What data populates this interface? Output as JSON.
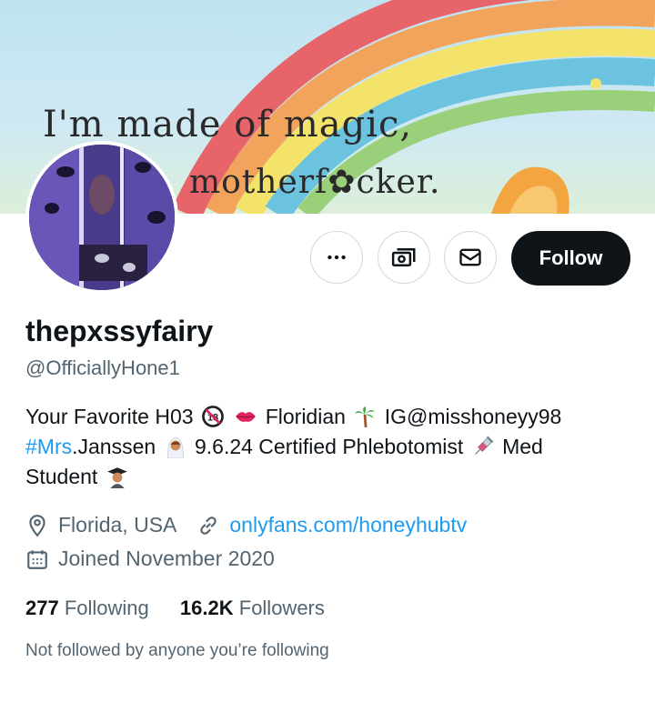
{
  "banner": {
    "line1": "I'm made of magic,",
    "line2": "motherf✿cker."
  },
  "actions": {
    "more_icon": "more-horizontal-icon",
    "subscribe_icon": "money-icon",
    "message_icon": "envelope-icon",
    "follow_label": "Follow"
  },
  "profile": {
    "name": "thepxssyfairy",
    "handle": "@OfficiallyHone1",
    "bio": {
      "part1": "Your Favorite H03",
      "part2": "Floridian",
      "part3": "IG@misshoneyy98",
      "hashtag": "#Mrs",
      "part4": ".Janssen",
      "part5": "9.6.24  Certified Phlebotomist",
      "part6": "Med",
      "part7": "Student"
    },
    "location": "Florida, USA",
    "website": "onlyfans.com/honeyhubtv",
    "joined": "Joined November 2020",
    "following_count": "277",
    "following_label": "Following",
    "followers_count": "16.2K",
    "followers_label": "Followers",
    "not_followed": "Not followed by anyone you’re following"
  },
  "colors": {
    "accent": "#1d9bf0",
    "text": "#0f1419",
    "secondary": "#536471",
    "border": "#cfd9de"
  }
}
